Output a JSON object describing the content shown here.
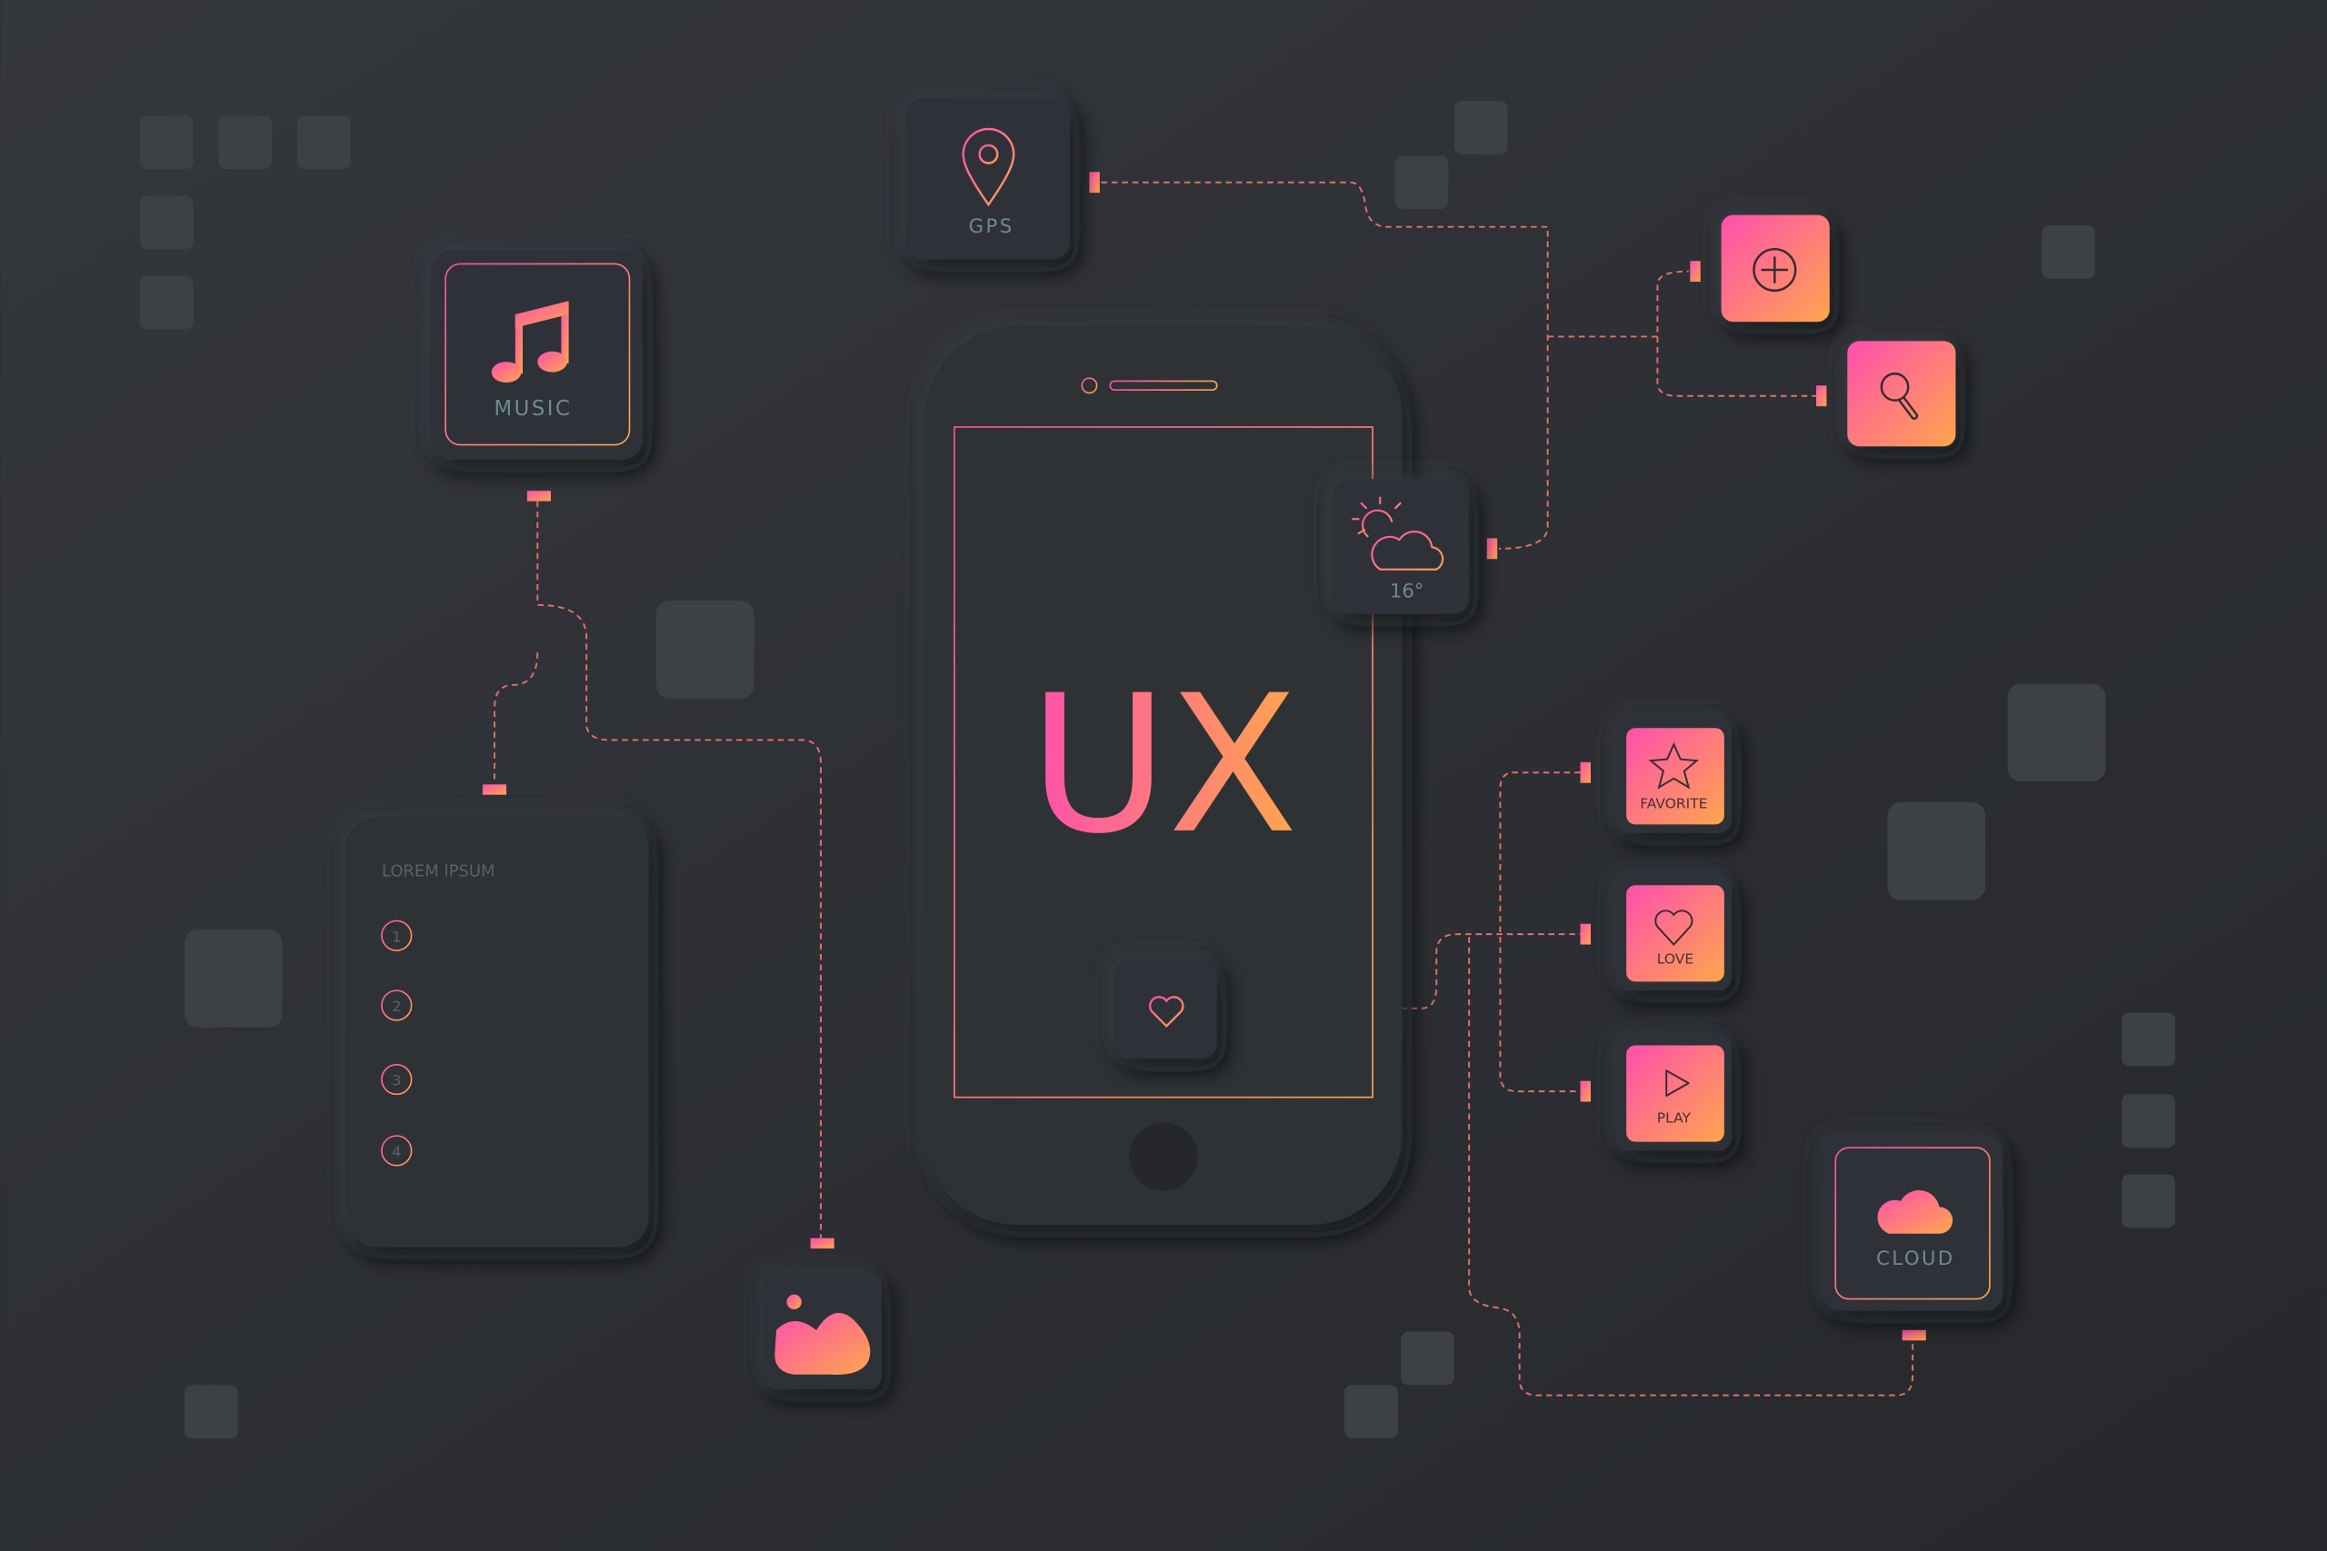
{
  "colors": {
    "background": "#2b2d32",
    "tile": "#2f3237",
    "decor_square": "#3d4045",
    "accent_pink": "#ff4fae",
    "accent_orange": "#ffa64d",
    "connector": "#e0706a",
    "muted_text": "#6f8a8a"
  },
  "phone": {
    "headline": "UX",
    "heart_button_icon": "heart-icon"
  },
  "gps": {
    "label": "GPS",
    "icon": "map-pin-icon"
  },
  "music": {
    "label": "MUSIC",
    "icon": "music-note-icon"
  },
  "weather": {
    "temperature": "16°",
    "icon": "sun-cloud-icon"
  },
  "actions": {
    "add_icon": "plus-circle-icon",
    "search_icon": "magnifier-icon"
  },
  "buttons": [
    {
      "label": "FAVORITE",
      "icon": "star-icon"
    },
    {
      "label": "LOVE",
      "icon": "heart-icon"
    },
    {
      "label": "PLAY",
      "icon": "play-icon"
    }
  ],
  "cloud": {
    "label": "CLOUD",
    "icon": "cloud-icon"
  },
  "image": {
    "icon": "image-icon"
  },
  "list_card": {
    "title": "LOREM IPSUM",
    "items": [
      "1",
      "2",
      "3",
      "4"
    ]
  }
}
